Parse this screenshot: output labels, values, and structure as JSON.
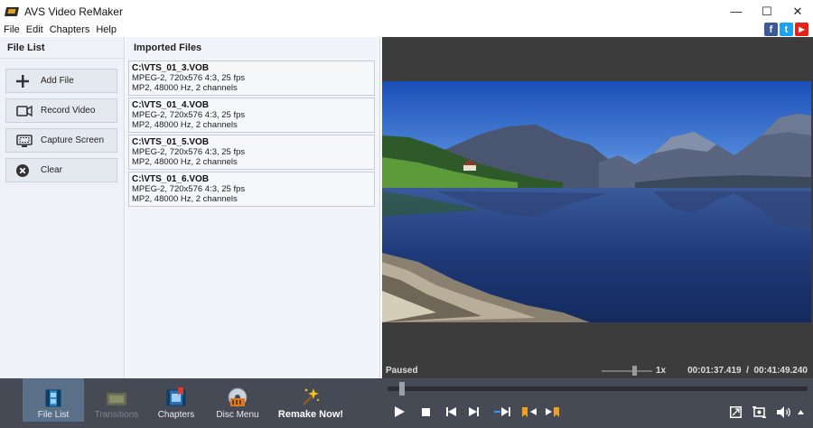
{
  "window": {
    "title": "AVS Video ReMaker",
    "minimize": "—",
    "maximize": "☐",
    "close": "✕"
  },
  "menu": [
    "File",
    "Edit",
    "Chapters",
    "Help"
  ],
  "social": {
    "facebook": "f",
    "twitter": "t",
    "youtube": "▶"
  },
  "file_list": {
    "header": "File List",
    "buttons": [
      {
        "label": "Add File",
        "icon": "plus-icon"
      },
      {
        "label": "Record Video",
        "icon": "camera-icon"
      },
      {
        "label": "Capture Screen",
        "icon": "screen-icon"
      },
      {
        "label": "Clear",
        "icon": "clear-icon"
      }
    ]
  },
  "imported": {
    "header": "Imported Files",
    "files": [
      {
        "name": "C:\\VTS_01_3.VOB",
        "video": "MPEG-2, 720x576 4:3, 25 fps",
        "audio": "MP2, 48000 Hz, 2 channels"
      },
      {
        "name": "C:\\VTS_01_4.VOB",
        "video": "MPEG-2, 720x576 4:3, 25 fps",
        "audio": "MP2, 48000 Hz, 2 channels"
      },
      {
        "name": "C:\\VTS_01_5.VOB",
        "video": "MPEG-2, 720x576 4:3, 25 fps",
        "audio": "MP2, 48000 Hz, 2 channels"
      },
      {
        "name": "C:\\VTS_01_6.VOB",
        "video": "MPEG-2, 720x576 4:3, 25 fps",
        "audio": "MP2, 48000 Hz, 2 channels"
      }
    ]
  },
  "player": {
    "status": "Paused",
    "speed": "1x",
    "time": "00:01:37.419  /  00:41:49.240"
  },
  "toolbar": {
    "file_list": "File List",
    "transitions": "Transitions",
    "chapters": "Chapters",
    "disc_menu": "Disc Menu",
    "remake": "Remake Now!"
  },
  "colors": {
    "accent": "#5a6f88",
    "chapter_marker": "#f0a020",
    "preview_bg": "#3c3c3c"
  }
}
